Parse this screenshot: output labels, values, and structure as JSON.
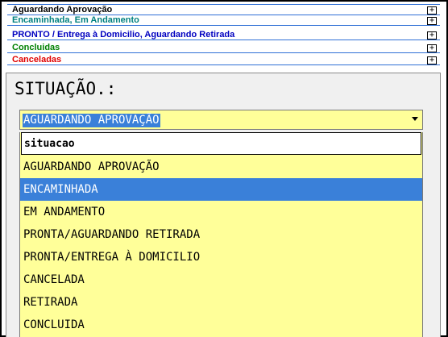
{
  "accordion": {
    "items": [
      {
        "label": "Aguardando Aprovação",
        "color": "#000000",
        "toggle": "+"
      },
      {
        "label": "Encaminhada, Em Andamento",
        "color": "#008080",
        "toggle": "+"
      },
      {
        "label": "PRONTO / Entrega à Domicilio, Aguardando Retirada",
        "color": "#0000c0",
        "toggle": "+"
      },
      {
        "label": "Concluidas",
        "color": "#008000",
        "toggle": "+"
      },
      {
        "label": "Canceladas",
        "color": "#e00000",
        "toggle": "+"
      }
    ]
  },
  "form": {
    "title": "SITUAÇÃO.:",
    "select": {
      "selected_label": "AGUARDANDO APROVAÇÃO",
      "background": "#ffff99"
    },
    "search_text": "situacao",
    "options": [
      {
        "label": "AGUARDANDO APROVAÇÃO",
        "highlighted": false
      },
      {
        "label": "ENCAMINHADA",
        "highlighted": true
      },
      {
        "label": "EM ANDAMENTO",
        "highlighted": false
      },
      {
        "label": "PRONTA/AGUARDANDO RETIRADA",
        "highlighted": false
      },
      {
        "label": "PRONTA/ENTREGA À DOMICILIO",
        "highlighted": false
      },
      {
        "label": "CANCELADA",
        "highlighted": false
      },
      {
        "label": "RETIRADA",
        "highlighted": false
      },
      {
        "label": "CONCLUIDA",
        "highlighted": false
      }
    ],
    "highlight_color": "#3a80d9"
  }
}
